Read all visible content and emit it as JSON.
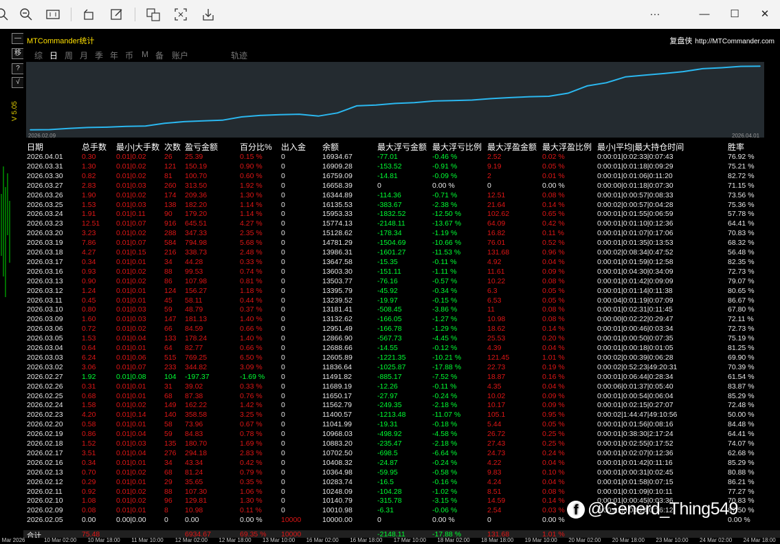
{
  "window": {
    "minimize": "—",
    "maximize": "☐",
    "close": "✕",
    "more": "···"
  },
  "panel": {
    "title": "MTCommander统计",
    "brand": "复盘侠",
    "brand_url": "http://MTCommander.com",
    "version": "V 5.05",
    "side_buttons": [
      "—",
      "移",
      "?",
      "√"
    ]
  },
  "tabs": [
    "综",
    "日",
    "周",
    "月",
    "季",
    "年",
    "币",
    "M",
    "备",
    "账户",
    "轨迹"
  ],
  "active_tab": "日",
  "chart_data": {
    "type": "line",
    "x_start_label": "2026.02.09",
    "x_end_label": "2026.04.01",
    "values": [
      10000,
      10010.98,
      10140.79,
      10248.09,
      10283.74,
      10364.98,
      10408.32,
      10702.5,
      10883.2,
      10968.03,
      11041.99,
      11400.57,
      11562.79,
      11650.17,
      11689.19,
      11491.82,
      11836.64,
      12605.89,
      12688.66,
      12866.9,
      12951.49,
      13132.62,
      13181.41,
      13239.52,
      13395.79,
      13503.77,
      13603.3,
      13647.58,
      13986.31,
      14781.29,
      15128.62,
      15774.13,
      15953.33,
      16135.53,
      16344.89,
      16658.39,
      16759.09,
      16909.28,
      16934.67
    ],
    "ylim": [
      9900,
      17100
    ],
    "color": "#2bb8f0",
    "grid": false
  },
  "table": {
    "headers": [
      "日期",
      "总手数",
      "最小|大手数",
      "次数",
      "盈亏金额",
      "百分比%",
      "出入金",
      "余额",
      "最大浮亏金额",
      "最大浮亏比例",
      "最大浮盈金额",
      "最大浮盈比例",
      "最小|平均|最大持仓时间",
      "胜率"
    ],
    "rows": [
      [
        "2026.04.01",
        "0.30",
        "0.01|0.02",
        "26",
        "25.39",
        "0.15 %",
        "0",
        "16934.67",
        "-77.01",
        "-0.46 %",
        "2.52",
        "0.02 %",
        "0:00:01|0:02:33|0:07:43",
        "76.92 %"
      ],
      [
        "2026.03.31",
        "1.30",
        "0.01|0.02",
        "121",
        "150.19",
        "0.90 %",
        "0",
        "16909.28",
        "-153.52",
        "-0.91 %",
        "9.19",
        "0.05 %",
        "0:00:01|0:01:18|0:09:29",
        "75.21 %"
      ],
      [
        "2026.03.30",
        "0.82",
        "0.01|0.02",
        "81",
        "100.70",
        "0.60 %",
        "0",
        "16759.09",
        "-14.81",
        "-0.09 %",
        "2",
        "0.01 %",
        "0:00:01|0:01:06|0:11:20",
        "82.72 %"
      ],
      [
        "2026.03.27",
        "2.83",
        "0.01|0.03",
        "260",
        "313.50",
        "1.92 %",
        "0",
        "16658.39",
        "0",
        "0.00 %",
        "0",
        "0.00 %",
        "0:00:00|0:01:18|0:07:30",
        "71.15 %"
      ],
      [
        "2026.03.26",
        "1.90",
        "0.01|0.02",
        "174",
        "209.36",
        "1.30 %",
        "0",
        "16344.89",
        "-114.36",
        "-0.71 %",
        "12.51",
        "0.08 %",
        "0:00:01|0:00:57|0:08:33",
        "73.56 %"
      ],
      [
        "2026.03.25",
        "1.53",
        "0.01|0.03",
        "138",
        "182.20",
        "1.14 %",
        "0",
        "16135.53",
        "-383.67",
        "-2.38 %",
        "21.64",
        "0.14 %",
        "0:00:02|0:00:57|0:04:28",
        "75.36 %"
      ],
      [
        "2026.03.24",
        "1.91",
        "0.01|0.11",
        "90",
        "179.20",
        "1.14 %",
        "0",
        "15953.33",
        "-1832.52",
        "-12.50 %",
        "102.62",
        "0.65 %",
        "0:00:01|0:01:55|0:06:59",
        "57.78 %"
      ],
      [
        "2026.03.23",
        "12.51",
        "0.01|0.07",
        "916",
        "645.51",
        "4.27 %",
        "0",
        "15774.13",
        "-2148.11",
        "-13.67 %",
        "64.09",
        "0.42 %",
        "0:00:01|0:01:10|0:12:36",
        "64.41 %"
      ],
      [
        "2026.03.20",
        "3.23",
        "0.01|0.02",
        "288",
        "347.33",
        "2.35 %",
        "0",
        "15128.62",
        "-178.34",
        "-1.19 %",
        "16.82",
        "0.11 %",
        "0:00:01|0:01:07|0:17:06",
        "70.83 %"
      ],
      [
        "2026.03.19",
        "7.86",
        "0.01|0.07",
        "584",
        "794.98",
        "5.68 %",
        "0",
        "14781.29",
        "-1504.69",
        "-10.66 %",
        "76.01",
        "0.52 %",
        "0:00:01|0:01:35|0:13:53",
        "68.32 %"
      ],
      [
        "2026.03.18",
        "4.27",
        "0.01|0.15",
        "216",
        "338.73",
        "2.48 %",
        "0",
        "13986.31",
        "-1601.27",
        "-11.53 %",
        "131.68",
        "0.96 %",
        "0:00:02|0:08:34|0:47:52",
        "56.48 %"
      ],
      [
        "2026.03.17",
        "0.34",
        "0.01|0.01",
        "34",
        "44.28",
        "0.33 %",
        "0",
        "13647.58",
        "-15.35",
        "-0.11 %",
        "4.92",
        "0.04 %",
        "0:00:01|0:01:59|0:12:58",
        "82.35 %"
      ],
      [
        "2026.03.16",
        "0.93",
        "0.01|0.02",
        "88",
        "99.53",
        "0.74 %",
        "0",
        "13603.30",
        "-151.11",
        "-1.11 %",
        "11.61",
        "0.09 %",
        "0:00:01|0:04:30|0:34:09",
        "72.73 %"
      ],
      [
        "2026.03.13",
        "0.90",
        "0.01|0.02",
        "86",
        "107.98",
        "0.81 %",
        "0",
        "13503.77",
        "-76.16",
        "-0.57 %",
        "10.22",
        "0.08 %",
        "0:00:01|0:01:42|0:09:09",
        "79.07 %"
      ],
      [
        "2026.03.12",
        "1.24",
        "0.01|0.01",
        "124",
        "156.27",
        "1.18 %",
        "0",
        "13395.79",
        "-45.92",
        "-0.34 %",
        "6.3",
        "0.05 %",
        "0:00:01|0:01:14|0:11:38",
        "80.65 %"
      ],
      [
        "2026.03.11",
        "0.45",
        "0.01|0.01",
        "45",
        "58.11",
        "0.44 %",
        "0",
        "13239.52",
        "-19.97",
        "-0.15 %",
        "6.53",
        "0.05 %",
        "0:00:04|0:01:19|0:07:09",
        "86.67 %"
      ],
      [
        "2026.03.10",
        "0.80",
        "0.01|0.03",
        "59",
        "48.79",
        "0.37 %",
        "0",
        "13181.41",
        "-508.45",
        "-3.86 %",
        "11",
        "0.08 %",
        "0:00:01|0:02:31|0:11:45",
        "67.80 %"
      ],
      [
        "2026.03.09",
        "1.60",
        "0.01|0.03",
        "147",
        "181.13",
        "1.40 %",
        "0",
        "13132.62",
        "-166.05",
        "-1.27 %",
        "10.98",
        "0.08 %",
        "0:00:00|0:02:22|0:29:47",
        "72.11 %"
      ],
      [
        "2026.03.06",
        "0.72",
        "0.01|0.02",
        "66",
        "84.59",
        "0.66 %",
        "0",
        "12951.49",
        "-166.78",
        "-1.29 %",
        "18.62",
        "0.14 %",
        "0:00:01|0:00:46|0:03:34",
        "72.73 %"
      ],
      [
        "2026.03.05",
        "1.53",
        "0.01|0.04",
        "133",
        "178.24",
        "1.40 %",
        "0",
        "12866.90",
        "-567.73",
        "-4.45 %",
        "25.53",
        "0.20 %",
        "0:00:01|0:00:50|0:07:35",
        "75.19 %"
      ],
      [
        "2026.03.04",
        "0.64",
        "0.01|0.01",
        "64",
        "82.77",
        "0.66 %",
        "0",
        "12688.66",
        "-14.55",
        "-0.12 %",
        "4.39",
        "0.04 %",
        "0:00:01|0:00:18|0:01:05",
        "81.25 %"
      ],
      [
        "2026.03.03",
        "6.24",
        "0.01|0.06",
        "515",
        "769.25",
        "6.50 %",
        "0",
        "12605.89",
        "-1221.35",
        "-10.21 %",
        "121.45",
        "1.01 %",
        "0:00:02|0:00:39|0:06:28",
        "69.90 %"
      ],
      [
        "2026.03.02",
        "3.06",
        "0.01|0.07",
        "233",
        "344.82",
        "3.09 %",
        "0",
        "11836.64",
        "-1025.87",
        "-17.88 %",
        "22.73",
        "0.19 %",
        "0:00:02|0:52:23|49:20:31",
        "70.39 %"
      ],
      [
        "2026.02.27",
        "1.92",
        "0.01|0.08",
        "104",
        "-197.37",
        "-1.69 %",
        "0",
        "11491.82",
        "-885.17",
        "-7.52 %",
        "18.87",
        "0.16 %",
        "0:00:01|0:06:44|0:28:34",
        "61.54 %"
      ],
      [
        "2026.02.26",
        "0.31",
        "0.01|0.01",
        "31",
        "39.02",
        "0.33 %",
        "0",
        "11689.19",
        "-12.26",
        "-0.11 %",
        "4.35",
        "0.04 %",
        "0:00:06|0:01:37|0:05:40",
        "83.87 %"
      ],
      [
        "2026.02.25",
        "0.68",
        "0.01|0.01",
        "68",
        "87.38",
        "0.76 %",
        "0",
        "11650.17",
        "-27.97",
        "-0.24 %",
        "10.02",
        "0.09 %",
        "0:00:01|0:00:54|0:06:04",
        "85.29 %"
      ],
      [
        "2026.02.24",
        "1.58",
        "0.01|0.02",
        "149",
        "162.22",
        "1.42 %",
        "0",
        "11562.79",
        "-249.35",
        "-2.18 %",
        "10.17",
        "0.09 %",
        "0:00:01|0:02:15|0:27:07",
        "72.48 %"
      ],
      [
        "2026.02.23",
        "4.20",
        "0.01|0.14",
        "140",
        "358.58",
        "3.25 %",
        "0",
        "11400.57",
        "-1213.48",
        "-11.07 %",
        "105.1",
        "0.95 %",
        "0:00:02|1:44:47|49:10:56",
        "50.00 %"
      ],
      [
        "2026.02.20",
        "0.58",
        "0.01|0.01",
        "58",
        "73.96",
        "0.67 %",
        "0",
        "11041.99",
        "-19.31",
        "-0.18 %",
        "5.44",
        "0.05 %",
        "0:00:01|0:01:56|0:08:16",
        "84.48 %"
      ],
      [
        "2026.02.19",
        "0.86",
        "0.01|0.04",
        "59",
        "84.83",
        "0.78 %",
        "0",
        "10968.03",
        "-498.92",
        "-4.58 %",
        "26.72",
        "0.25 %",
        "0:00:01|0:38:30|2:17:24",
        "64.41 %"
      ],
      [
        "2026.02.18",
        "1.52",
        "0.01|0.03",
        "135",
        "180.70",
        "1.69 %",
        "0",
        "10883.20",
        "-235.47",
        "-2.18 %",
        "27.43",
        "0.25 %",
        "0:00:01|0:02:55|0:17:52",
        "74.07 %"
      ],
      [
        "2026.02.17",
        "3.51",
        "0.01|0.04",
        "276",
        "294.18",
        "2.83 %",
        "0",
        "10702.50",
        "-698.5",
        "-6.64 %",
        "24.73",
        "0.24 %",
        "0:00:01|0:02:07|0:12:36",
        "62.68 %"
      ],
      [
        "2026.02.16",
        "0.34",
        "0.01|0.01",
        "34",
        "43.34",
        "0.42 %",
        "0",
        "10408.32",
        "-24.87",
        "-0.24 %",
        "4.22",
        "0.04 %",
        "0:00:01|0:01:42|0:11:16",
        "85.29 %"
      ],
      [
        "2026.02.13",
        "0.70",
        "0.01|0.02",
        "68",
        "81.24",
        "0.79 %",
        "0",
        "10364.98",
        "-59.95",
        "-0.58 %",
        "9.83",
        "0.10 %",
        "0:00:01|0:00:31|0:02:45",
        "80.88 %"
      ],
      [
        "2026.02.12",
        "0.29",
        "0.01|0.01",
        "29",
        "35.65",
        "0.35 %",
        "0",
        "10283.74",
        "-16.5",
        "-0.16 %",
        "4.24",
        "0.04 %",
        "0:00:01|0:01:58|0:07:15",
        "86.21 %"
      ],
      [
        "2026.02.11",
        "0.92",
        "0.01|0.02",
        "88",
        "107.30",
        "1.06 %",
        "0",
        "10248.09",
        "-104.28",
        "-1.02 %",
        "8.51",
        "0.08 %",
        "0:00:01|0:01:09|0:10:11",
        "77.27 %"
      ],
      [
        "2026.02.10",
        "1.08",
        "0.01|0.02",
        "96",
        "129.81",
        "1.30 %",
        "0",
        "10140.79",
        "-315.78",
        "-3.15 %",
        "14.59",
        "0.14 %",
        "0:00:01|0:00:45|0:03:36",
        "70.83 %"
      ],
      [
        "2026.02.09",
        "0.08",
        "0.01|0.01",
        "8",
        "10.98",
        "0.11 %",
        "0",
        "10010.98",
        "-6.31",
        "-0.06 %",
        "2.54",
        "0.03 %",
        "0:00:01|0:04:24|0:16:12",
        "87.50 %"
      ],
      [
        "2026.02.05",
        "0.00",
        "0.00|0.00",
        "0",
        "0.00",
        "0.00 %",
        "10000",
        "10000.00",
        "0",
        "0.00 %",
        "0",
        "0.00 %",
        "",
        "0.00 %"
      ]
    ],
    "total": [
      "合计",
      "75.48",
      "",
      "",
      "6934.67",
      "69.35 %",
      "10000",
      "",
      "-2148.11",
      "-17.88 %",
      "131.68",
      "1.01 %",
      "",
      ""
    ]
  },
  "timeline": [
    "9 Mar 2026",
    "10 Mar 02:00",
    "10 Mar 18:00",
    "11 Mar 10:00",
    "12 Mar 02:00",
    "12 Mar 18:00",
    "13 Mar 10:00",
    "16 Mar 02:00",
    "16 Mar 18:00",
    "17 Mar 10:00",
    "18 Mar 02:00",
    "18 Mar 18:00",
    "19 Mar 10:00",
    "20 Mar 02:00",
    "20 Mar 18:00",
    "23 Mar 10:00",
    "24 Mar 02:00",
    "24 Mar 18:00"
  ],
  "watermark": {
    "icon": "f",
    "text": "@Generd_Thing549"
  }
}
